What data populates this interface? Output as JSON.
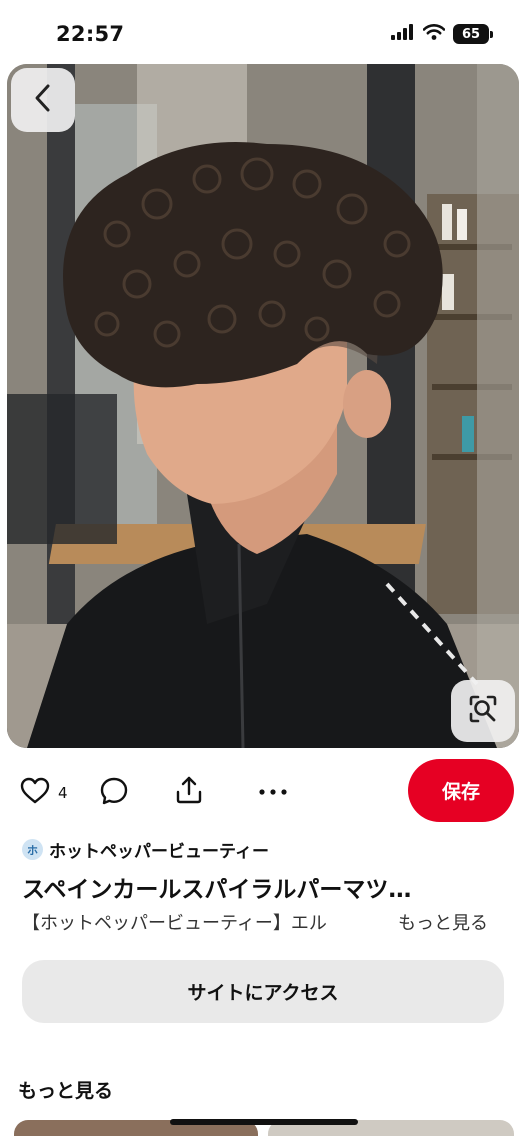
{
  "status_bar": {
    "time": "22:57",
    "battery": "65"
  },
  "pin": {
    "like_count": "4",
    "save_label": "保存",
    "source": {
      "avatar_initial": "ホ",
      "name": "ホットペッパービューティー"
    },
    "title": "スペインカールスパイラルパーマツ…",
    "description": "【ホットペッパービューティー】エル",
    "more_link": "もっと見る",
    "visit_label": "サイトにアクセス"
  },
  "section": {
    "more_heading": "もっと見る"
  },
  "colors": {
    "accent": "#e60023",
    "button_gray": "#e9e9e9",
    "text": "#111111"
  },
  "icons": {
    "back": "chevron-left-icon",
    "lens": "visual-search-icon",
    "like": "heart-icon",
    "comment": "comment-icon",
    "share": "share-icon",
    "more": "more-horizontal-icon"
  }
}
